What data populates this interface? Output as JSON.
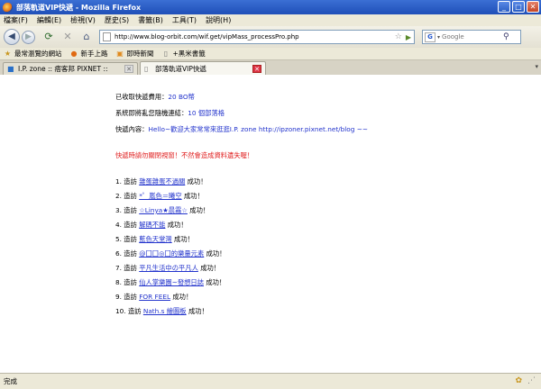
{
  "window": {
    "title": "部落軌道VIP快遞 - Mozilla Firefox",
    "min_glyph": "_",
    "max_glyph": "□",
    "close_glyph": "✕"
  },
  "menu": {
    "items": [
      "檔案(F)",
      "編輯(E)",
      "檢視(V)",
      "歷史(S)",
      "書籤(B)",
      "工具(T)",
      "說明(H)"
    ]
  },
  "nav": {
    "url": "http://www.blog-orbit.com/wif.get/vipMass_processPro.php",
    "search_placeholder": "Google",
    "search_engine_glyph": "G"
  },
  "bookmarks": {
    "items": [
      {
        "label": "最常瀏覽的網站",
        "icon": "star-folder-icon"
      },
      {
        "label": "新手上路",
        "icon": "firefox-icon"
      },
      {
        "label": "即時新聞",
        "icon": "rss-folder-icon"
      },
      {
        "label": "+黑米書籤",
        "icon": "page-icon"
      }
    ]
  },
  "tabs": [
    {
      "label": "I.P. zone :: 痞客邦 PIXNET ::",
      "active": false
    },
    {
      "label": "部落軌道VIP快遞",
      "active": true
    }
  ],
  "content": {
    "fee_label": "已收取快遞費用：",
    "fee_value": "20 BO幣",
    "count_prefix": "系統即將亂您隨機連結：",
    "count_value": "10 個部落格",
    "message_label": "快遞內容：",
    "message_value": "Hello~歡迎大家常常來逛逛I.P. zone http://ipzoner.pixnet.net/blog ~~",
    "warning": "快遞時請勿關閉視窗！不然會造成資料遺失喔！",
    "visit_word": "造訪",
    "success_word": "成功！",
    "visits": [
      {
        "num": "1.",
        "blog": "雜蛋雜蛋不過關"
      },
      {
        "num": "2.",
        "blog": "*゜嵐色＝曦空"
      },
      {
        "num": "3.",
        "blog": "☆Linya★晨霧☆"
      },
      {
        "num": "4.",
        "blog": "解碼不能"
      },
      {
        "num": "5.",
        "blog": "藍色天堂灣"
      },
      {
        "num": "6.",
        "blog": "@囗囗◎囗的樂量元素"
      },
      {
        "num": "7.",
        "blog": "平凡生活中の平凡人"
      },
      {
        "num": "8.",
        "blog": "仙人掌樂園~發想日誌"
      },
      {
        "num": "9.",
        "blog": "FOR FEEL"
      },
      {
        "num": "10.",
        "blog": "Nath.s 繪圖板"
      }
    ]
  },
  "status": {
    "text": "完成"
  }
}
